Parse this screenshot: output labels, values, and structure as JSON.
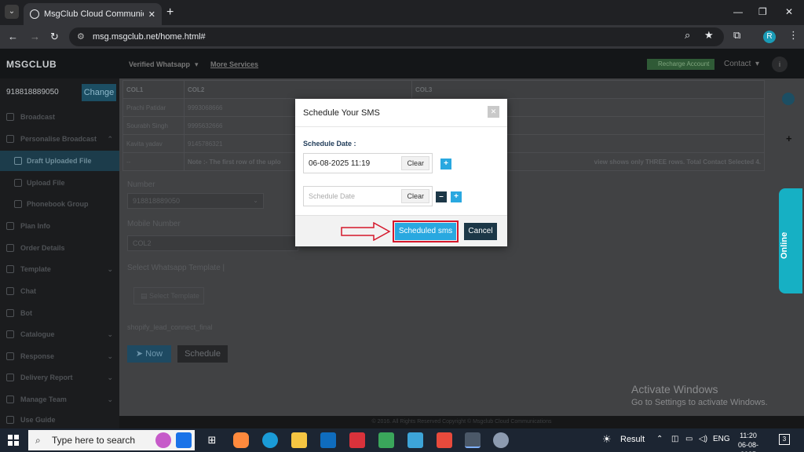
{
  "browser": {
    "tab_title": "MsgClub Cloud Communication",
    "url": "msg.msgclub.net/home.html#",
    "profile_initial": "R"
  },
  "topnav": {
    "brand": "MSGCLUB",
    "links": [
      "Verified Whatsapp",
      "More Services"
    ],
    "recharge": "Recharge Account",
    "contact": "Contact"
  },
  "sidebar": {
    "number": "918818889050",
    "change_label": "Change",
    "items": [
      {
        "label": "Broadcast"
      },
      {
        "label": "Personalise Broadcast"
      },
      {
        "label": "Draft Uploaded File"
      },
      {
        "label": "Upload File"
      },
      {
        "label": "Phonebook Group"
      },
      {
        "label": "Plan Info"
      },
      {
        "label": "Order Details"
      },
      {
        "label": "Template"
      },
      {
        "label": "Chat"
      },
      {
        "label": "Bot"
      },
      {
        "label": "Catalogue"
      },
      {
        "label": "Response"
      },
      {
        "label": "Delivery Report"
      },
      {
        "label": "Manage Team"
      },
      {
        "label": "Use Guide"
      }
    ]
  },
  "sheet": {
    "headers": [
      "COL1",
      "COL2",
      "COL3"
    ],
    "rows": [
      [
        "Prachi Patidar",
        "9993068666",
        ""
      ],
      [
        "Sourabh Singh",
        "9995632666",
        ""
      ],
      [
        "Kavita yadav",
        "9145786321",
        ""
      ]
    ],
    "note_cell": "--",
    "note_left": "Note :- The first row of the uplo",
    "note_right": "view shows only THREE rows. Total Contact Selected 4."
  },
  "form": {
    "number_label": "Number",
    "number_value": "918818889050",
    "mobile_label": "Mobile Number",
    "mobile_value": "COL2",
    "template_label": "Select Whatsapp Template |",
    "select_template": "Select Template",
    "template_name": "shopify_lead_connect_final",
    "now_label": "Now",
    "schedule_label": "Schedule"
  },
  "footer_text": "© 2016. All Rights Reserved Copyright © Msgclub Cloud Communications",
  "online_label": "Online",
  "activate": {
    "title": "Activate Windows",
    "subtitle": "Go to Settings to activate Windows."
  },
  "modal": {
    "title": "Schedule Your SMS",
    "schedule_date_label": "Schedule Date :",
    "date1_value": "06-08-2025 11:19",
    "date2_placeholder": "Schedule Date",
    "clear_label": "Clear",
    "scheduled_btn": "Scheduled sms",
    "cancel_btn": "Cancel",
    "highlight_color": "#d5172b",
    "accent_color": "#29a8e0"
  },
  "taskbar": {
    "search_placeholder": "Type here to search",
    "result_label": "Result",
    "language": "ENG",
    "time": "11:20",
    "date": "06-08-2025"
  }
}
